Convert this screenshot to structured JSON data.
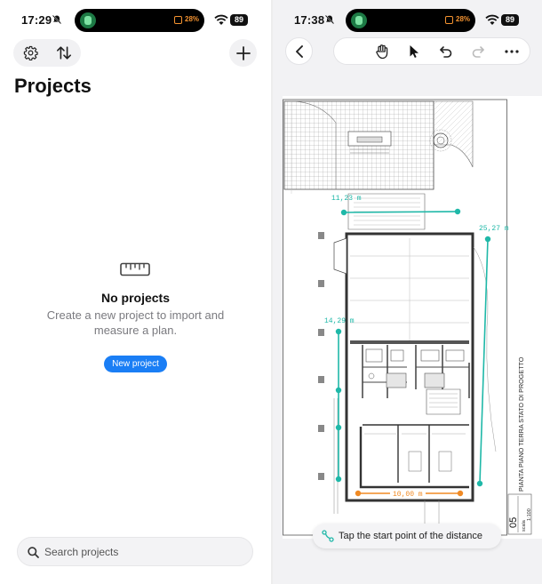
{
  "left": {
    "status": {
      "time": "17:29",
      "battery_pct": "28%",
      "battery_level": "89"
    },
    "title": "Projects",
    "empty_state": {
      "title": "No projects",
      "description": "Create a new project to import and measure a plan.",
      "button": "New project"
    },
    "search": {
      "placeholder": "Search projects",
      "value": ""
    },
    "icons": [
      "gear-icon",
      "sort-arrows-icon",
      "plus-icon",
      "ruler-icon",
      "search-icon"
    ]
  },
  "right": {
    "status": {
      "time": "17:38",
      "battery_pct": "28%",
      "battery_level": "89"
    },
    "toolbar_icons": [
      "back-chevron-icon",
      "hand-icon",
      "pointer-icon",
      "undo-icon",
      "redo-icon",
      "more-icon"
    ],
    "plan": {
      "sheet_title": "PIANTA PIANO TERRA STATO DI PROGETTO",
      "sheet_number": "05",
      "scale_label": "scala",
      "scale_value": "1:100"
    },
    "measurements": [
      {
        "label": "11,23 m",
        "color": "#1fb8a8"
      },
      {
        "label": "25,27 m",
        "color": "#1fb8a8"
      },
      {
        "label": "14,29 m",
        "color": "#1fb8a8"
      },
      {
        "label": "10,00 m",
        "color": "#f08a24"
      }
    ],
    "hint": "Tap the start point of the distance"
  },
  "colors": {
    "accent": "#1a7ef5",
    "measure_teal": "#1fb8a8",
    "measure_orange": "#f08a24"
  }
}
